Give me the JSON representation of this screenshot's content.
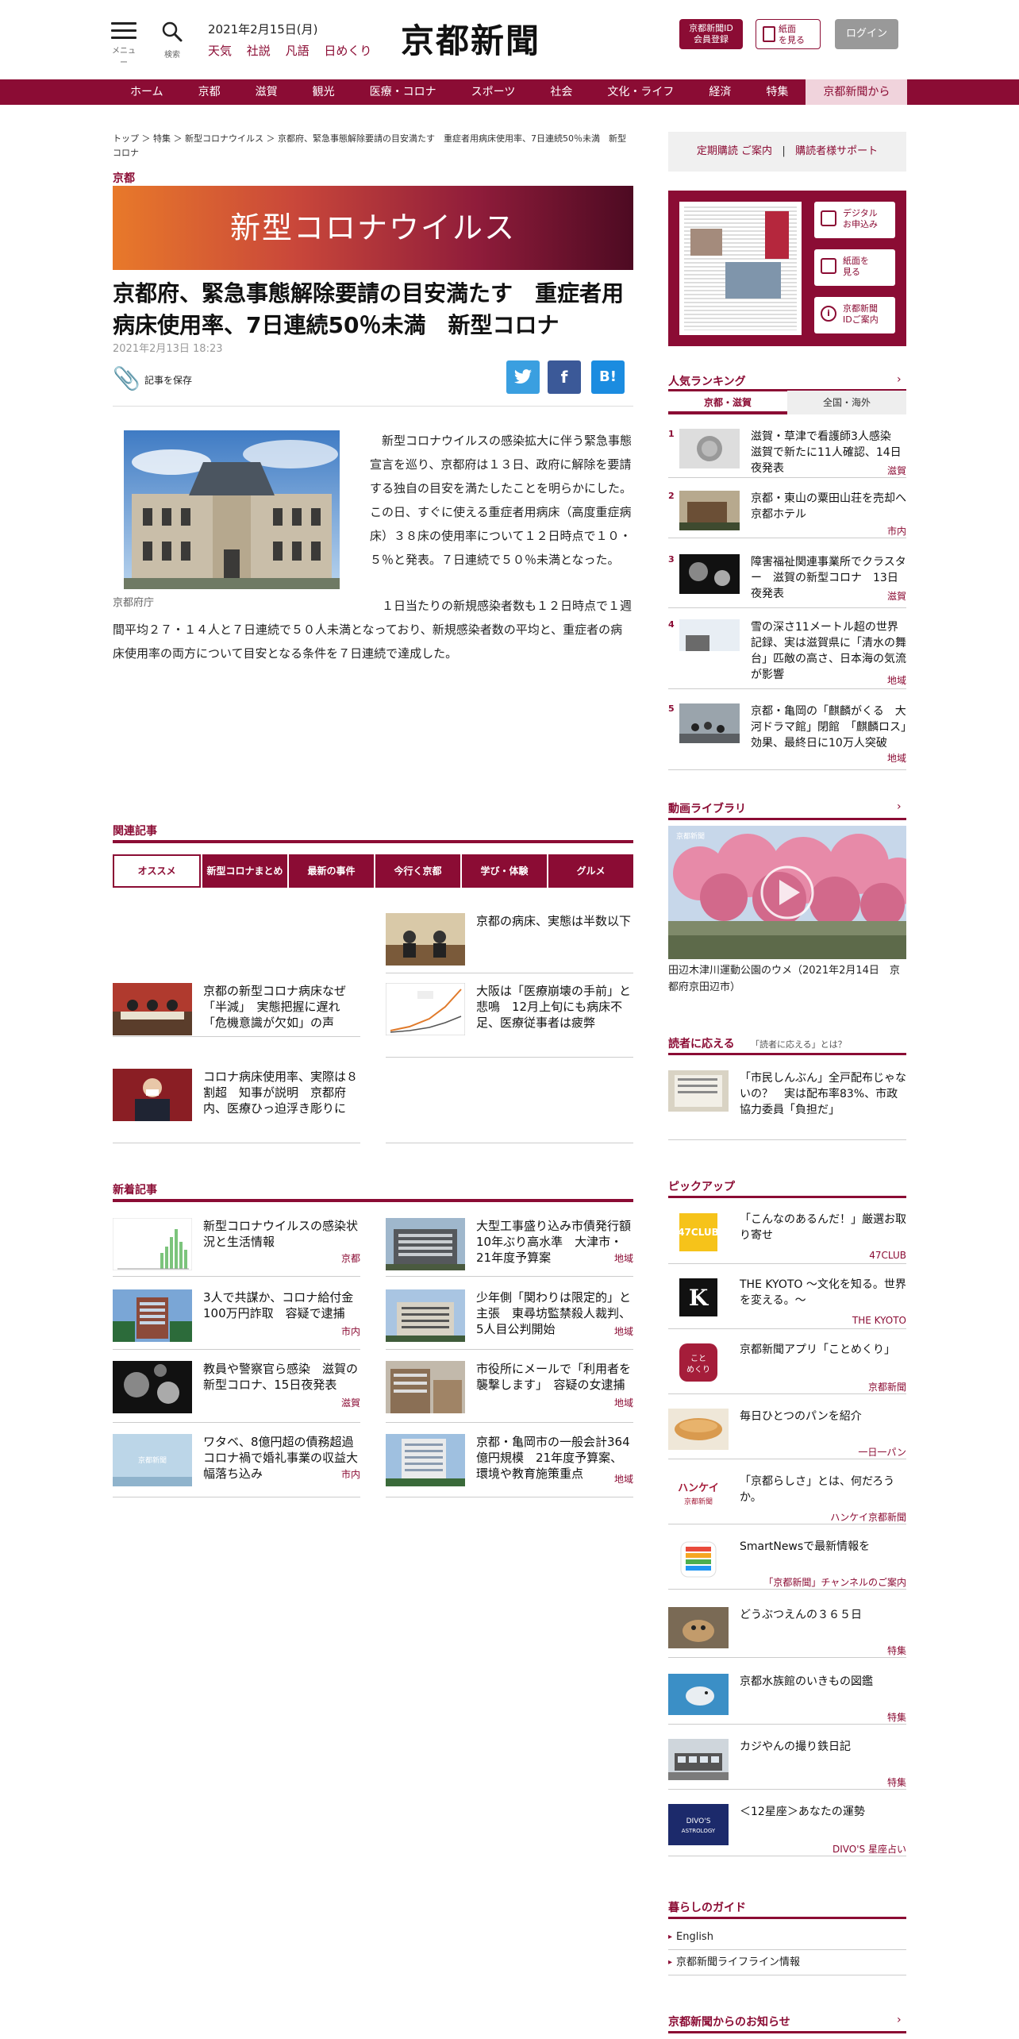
{
  "header": {
    "menu_label": "メニュー",
    "search_label": "検索",
    "date": "2021年2月15日(月)",
    "quick_links": [
      "天気",
      "社説",
      "凡語",
      "日めくり"
    ],
    "logo": "京都新聞",
    "id_button": [
      "京都新聞ID",
      "会員登録"
    ],
    "paper_button": [
      "紙面",
      "を見る"
    ],
    "login_button": "ログイン"
  },
  "nav": {
    "items": [
      "ホーム",
      "京都",
      "滋賀",
      "観光",
      "医療・コロナ",
      "スポーツ",
      "社会",
      "文化・ライフ",
      "経済",
      "特集",
      "京都新聞から"
    ]
  },
  "article": {
    "breadcrumb": "トップ ＞ 特集 ＞ 新型コロナウイルス ＞ 京都府、緊急事態解除要請の目安満たす　重症者用病床使用率、7日連続50％未満　新型コロナ",
    "category": "京都",
    "banner": "新型コロナウイルス",
    "headline": "京都府、緊急事態解除要請の目安満たす　重症者用病床使用率、7日連続50％未満　新型コロナ",
    "date": "2021年2月13日 18:23",
    "save_label": "記事を保存",
    "photo_caption": "京都府庁",
    "paragraphs": [
      "新型コロナウイルスの感染拡大に伴う緊急事態宣言を巡り、京都府は１３日、政府に解除を要請する独自の目安を満たしたことを明らかにした。この日、すぐに使える重症者用病床（高度重症病床）３８床の使用率について１２日時点で１０・５％と発表。７日連続で５０％未満となった。",
      "１日当たりの新規感染者数も１２日時点で１週間平均２７・１４人と７日連続で５０人未満となっており、新規感染者数の平均と、重症者の病床使用率の両方について目安となる条件を７日連続で達成した。"
    ]
  },
  "related": {
    "title": "関連記事",
    "tabs": [
      "オススメ",
      "新型コロナまとめ",
      "最新の事件",
      "今行く京都",
      "学び・体験",
      "グルメ"
    ],
    "items": [
      {
        "title": "京都の病床、実態は半数以下"
      },
      {
        "title": "京都の新型コロナ病床なぜ「半減」　実態把握に遅れ「危機意識が欠如」の声"
      },
      {
        "title": "大阪は「医療崩壊の手前」と悲鳴　12月上旬にも病床不足、医療従事者は疲弊"
      },
      {
        "title": "コロナ病床使用率、実際は８割超　知事が説明　京都府内、医療ひっ迫浮き彫りに"
      }
    ]
  },
  "latest": {
    "title": "新着記事",
    "items": [
      {
        "title": "新型コロナウイルスの感染状況と生活情報",
        "tag": "京都"
      },
      {
        "title": "大型工事盛り込み市債発行額10年ぶり高水準　大津市・21年度予算案",
        "tag": "地域"
      },
      {
        "title": "3人で共謀か、コロナ給付金100万円詐取　容疑で逮捕",
        "tag": "市内"
      },
      {
        "title": "少年側「関わりは限定的」と主張　東尋坊監禁殺人裁判、5人目公判開始",
        "tag": "地域"
      },
      {
        "title": "教員や警察官ら感染　滋賀の新型コロナ、15日夜発表",
        "tag": "滋賀"
      },
      {
        "title": "市役所にメールで「利用者を襲撃します」　容疑の女逮捕",
        "tag": "地域"
      },
      {
        "title": "ワタベ、8億円超の債務超過　コロナ禍で婚礼事業の収益大幅落ち込み",
        "tag": "市内"
      },
      {
        "title": "京都・亀岡市の一般会計364億円規模　21年度予算案、環境や教育施策重点",
        "tag": "地域"
      }
    ]
  },
  "sidebar": {
    "subscription": [
      "定期購読 ご案内",
      "|",
      "購読者様サポート"
    ],
    "paper_buttons": [
      [
        "デジタル",
        "お申込み"
      ],
      [
        "紙面を",
        "見る"
      ],
      [
        "京都新聞",
        "IDご案内"
      ]
    ],
    "ranking": {
      "title": "人気ランキング",
      "tabs": [
        "京都・滋賀",
        "全国・海外"
      ],
      "items": [
        {
          "num": "1",
          "title": "滋賀・草津で看護師3人感染　滋賀で新たに11人確認、14日夜発表",
          "tag": "滋賀"
        },
        {
          "num": "2",
          "title": "京都・東山の粟田山荘を売却へ　京都ホテル",
          "tag": "市内"
        },
        {
          "num": "3",
          "title": "障害福祉関連事業所でクラスター　滋賀の新型コロナ　13日夜発表",
          "tag": "滋賀"
        },
        {
          "num": "4",
          "title": "雪の深さ11メートル超の世界記録、実は滋賀県に「清水の舞台」匹敵の高さ、日本海の気流が影響",
          "tag": "地域"
        },
        {
          "num": "5",
          "title": "京都・亀岡の「麒麟がくる　大河ドラマ館」閉館　「麒麟ロス」効果、最終日に10万人突破",
          "tag": "地域"
        }
      ]
    },
    "video": {
      "title": "動画ライブラリ",
      "watermark": "京都新聞",
      "caption": "田辺木津川運動公園のウメ（2021年2月14日　京都府京田辺市）"
    },
    "reader": {
      "title": "読者に応える",
      "sub": "「読者に応える」とは？",
      "item": "「市民しんぶん」全戸配布じゃないの？　実は配布率83%、市政協力委員「負担だ」"
    },
    "pickup": {
      "title": "ピックアップ",
      "items": [
        {
          "title": "「こんなのあるんだ！」厳選お取り寄せ",
          "tag": "47CLUB",
          "icon": "47CLUB"
        },
        {
          "title": "THE KYOTO ～文化を知る。世界を変える。～",
          "tag": "THE KYOTO",
          "icon": "K"
        },
        {
          "title": "京都新聞アプリ「ことめくり」",
          "tag": "京都新聞",
          "icon": "こと めくり"
        },
        {
          "title": "毎日ひとつのパンを紹介",
          "tag": "一日一パン"
        },
        {
          "title": "「京都らしさ」とは、何だろうか。",
          "tag": "ハンケイ京都新聞",
          "icon": [
            "ハンケイ",
            "京都新聞"
          ]
        },
        {
          "title": "SmartNewsで最新情報を",
          "tag": "「京都新聞」チャンネルのご案内"
        },
        {
          "title": "どうぶつえんの３６５日",
          "tag": "特集"
        },
        {
          "title": "京都水族館のいきもの図鑑",
          "tag": "特集"
        },
        {
          "title": "カジやんの撮り鉄日記",
          "tag": "特集"
        },
        {
          "title": "＜12星座＞あなたの運勢",
          "tag": "DIVO'S 星座占い",
          "icon": [
            "DIVO'S",
            "ASTROLOGY"
          ]
        }
      ]
    },
    "guide": {
      "title": "暮らしのガイド",
      "items": [
        "English",
        "京都新聞ライフライン情報"
      ]
    },
    "notice": {
      "title": "京都新聞からのお知らせ"
    }
  },
  "colors": {
    "brand": "#8b0c34",
    "twitter": "#3a9fe0",
    "facebook": "#3b5998",
    "hatena": "#1b8ce0"
  }
}
